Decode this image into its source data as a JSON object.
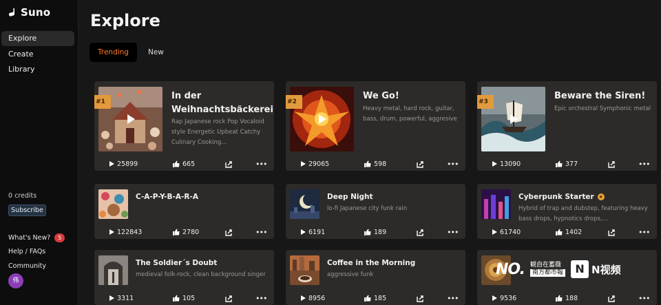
{
  "app": {
    "name": "Suno"
  },
  "sidebar": {
    "items": [
      {
        "label": "Explore"
      },
      {
        "label": "Create"
      },
      {
        "label": "Library"
      }
    ],
    "credits": "0 credits",
    "subscribe_label": "Subscribe",
    "footer": [
      {
        "label": "What's New?",
        "badge": "5"
      },
      {
        "label": "Help / FAQs"
      },
      {
        "label": "Community"
      }
    ],
    "avatar_initial": "伟"
  },
  "main": {
    "title": "Explore",
    "tabs": [
      {
        "label": "Trending",
        "active": true
      },
      {
        "label": "New",
        "active": false
      }
    ],
    "songs": [
      {
        "rank": "#1",
        "title": "In der Weihnachtsbäckerei",
        "desc": "Rap Japanese rock Pop Vocaloid style Energetic Upbeat Catchy Culinary Cooking...",
        "plays": "25899",
        "likes": "665"
      },
      {
        "rank": "#2",
        "title": "We Go!",
        "desc": "Heavy metal, hard rock, guitar, bass, drum, powerful, aggresive",
        "plays": "29065",
        "likes": "598"
      },
      {
        "rank": "#3",
        "title": "Beware the Siren!",
        "desc": "Epic orchestral Symphonic metal",
        "plays": "13090",
        "likes": "377"
      },
      {
        "title": "C-A-P-Y-B-A-R-A",
        "desc": "",
        "plays": "122843",
        "likes": "2780"
      },
      {
        "title": "Deep Night",
        "desc": "lo-fi Japanese city funk rain",
        "plays": "6191",
        "likes": "189"
      },
      {
        "title": "Cyberpunk Starter",
        "desc": "Hybrid of trap and dubstep, featuring heavy bass drops, hypnotics drops,...",
        "plays": "61740",
        "likes": "1402",
        "verified": "★"
      },
      {
        "title": "The Soldier´s Doubt",
        "desc": "medieval folk-rock, clean background singer",
        "plays": "3311",
        "likes": "105"
      },
      {
        "title": "Coffee in the Morning",
        "desc": "aggressive funk",
        "plays": "8956",
        "likes": "185"
      },
      {
        "title": "",
        "desc": "",
        "plays": "9536",
        "likes": "188"
      }
    ]
  },
  "watermark": {
    "a": "NO.",
    "b1": "観自在蓄薇",
    "b2": "南方都市報",
    "c": "N视频"
  },
  "colors": {
    "accent": "#ff7a2a",
    "rank_badge": "#e39a3c",
    "card_bg": "#2d2b29"
  }
}
